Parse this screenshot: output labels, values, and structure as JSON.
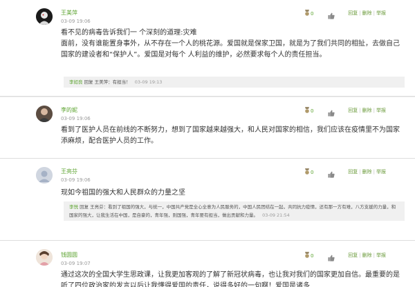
{
  "comments": [
    {
      "author": "王美萍",
      "time": "03-09 19:06",
      "likes": "0",
      "actions": {
        "reply": "回复",
        "delete": "删除",
        "report": "举报"
      },
      "body": "看不见的病毒告诉我们一 个深刻的道理:灾难\n面前，没有谁能置身事外，从不存在一个人的桃花源。爱国就是保家卫国，就是为了我们共同的相扯，去做自己国家的建设者和“保护人”。爱国是对每个 人利益的维护，必然要求每个人的责任担当。",
      "reply": {
        "author": "李如良",
        "to": "回复 王美萍：",
        "text": "有担当！",
        "time": "03-09 19:13"
      }
    },
    {
      "author": "李的妮",
      "time": "03-09 19:06",
      "likes": "0",
      "actions": {
        "reply": "回复",
        "delete": "删除",
        "report": "举报"
      },
      "body": "看到了医护人员在前线的不断努力，想到了国家越来越强大，和人民对国家的相信，我们应该在疫情里不为国家添麻烦，配合医护人员的工作。"
    },
    {
      "author": "王亮芬",
      "time": "03-09 19:06",
      "likes": "0",
      "actions": {
        "reply": "回复",
        "delete": "删除",
        "report": "举报"
      },
      "body": "现如今祖国的强大和人民群众的力量之坚",
      "reply": {
        "author": "李悦",
        "to": "回复 王亮芬：",
        "text": "看到了祖国的强大，与统一，中国共产党是全心全意为人民服务的，中国人民团结在一起，共同抗力疫情，还有那一方有难，八方支援的力量，和国家的强大，让我生活在中国，是自豪的，青年强，则国强，青年要有担当，做出贡献和力量。",
        "time": "03-09 21:54"
      }
    },
    {
      "author": "钱圆圆",
      "time": "03-09 19:07",
      "likes": "0",
      "actions": {
        "reply": "回复",
        "delete": "删除",
        "report": "举报"
      },
      "body": "通过这次的全国大学生思政课，让我更加客观的了解了新冠状病毒，也让我对我们的国家更加自信。最重要的是听了四位政治家的发言以后让我懂得爱国的责任，说得多好的一句啊！爱国是诸多"
    }
  ],
  "colors": {
    "author": "#5aa22d",
    "actions": "#6a9a3a",
    "time": "#999999",
    "body": "#333333"
  },
  "icons": {
    "likes": "medal-icon",
    "thumb": "thumbs-up-icon"
  }
}
